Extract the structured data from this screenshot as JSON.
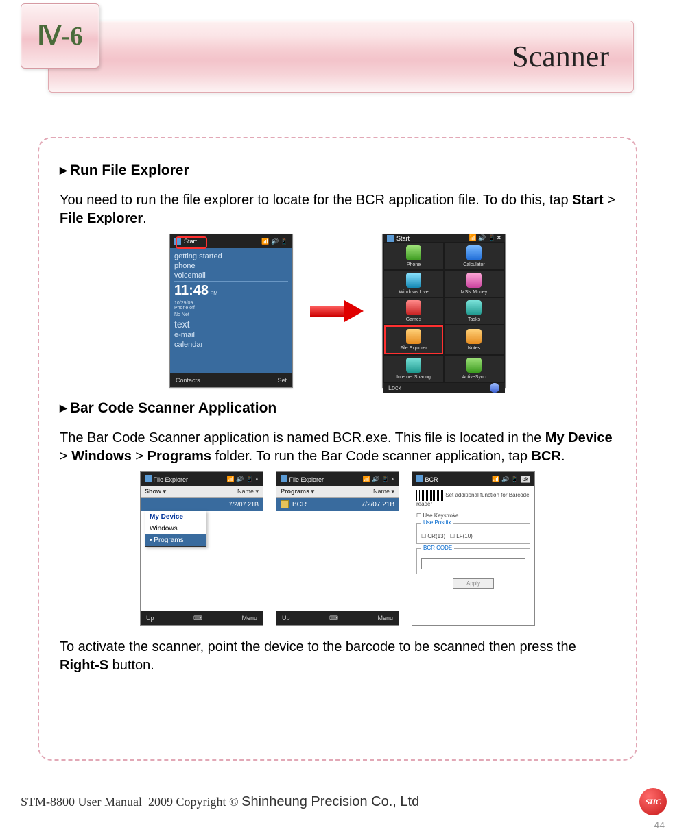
{
  "header": {
    "section_number": "Ⅳ-6",
    "title": "Scanner"
  },
  "section1": {
    "heading": "Run File Explorer",
    "para_before": "You need to run the file explorer to locate for the BCR application file. To do this, tap ",
    "bold1": "Start",
    "mid": " > ",
    "bold2": "File Explorer",
    "after": "."
  },
  "screenA": {
    "start": "Start",
    "lines": [
      "getting started",
      "phone",
      "voicemail"
    ],
    "clock": "11:48",
    "pm": "PM",
    "date": "10/29/09",
    "phoneoff": "Phone off",
    "nonet": "No Net",
    "text": "text",
    "email": "e-mail",
    "calendar": "calendar",
    "foot_l": "Contacts",
    "foot_r": "Set"
  },
  "screenB": {
    "start": "Start",
    "items": [
      {
        "label": "Phone"
      },
      {
        "label": "Calculator"
      },
      {
        "label": "Windows Live"
      },
      {
        "label": "MSN Money"
      },
      {
        "label": "Games"
      },
      {
        "label": "Tasks"
      },
      {
        "label": "File Explorer"
      },
      {
        "label": "Notes"
      },
      {
        "label": "Internet Sharing"
      },
      {
        "label": "ActiveSync"
      }
    ],
    "foot": "Lock"
  },
  "section2": {
    "heading": "Bar Code Scanner Application",
    "para": "The Bar Code Scanner application is named BCR.exe.  This file is located in the ",
    "b1": "My Device",
    "s1": " > ",
    "b2": "Windows",
    "s2": " > ",
    "b3": "Programs",
    "mid": " folder. To run the Bar Code scanner application, tap ",
    "b4": "BCR",
    "end": "."
  },
  "screenC": {
    "title": "File Explorer",
    "sub_l": "Show",
    "sub_r": "Name",
    "row_l": "",
    "row_r": "7/2/07   21B",
    "menu": [
      "My Device",
      "Windows",
      "• Programs"
    ],
    "foot_l": "Up",
    "foot_r": "Menu"
  },
  "screenD": {
    "title": "File Explorer",
    "sub_l": "Programs",
    "sub_r": "Name",
    "item": "BCR",
    "row_r": "7/2/07   21B",
    "foot_l": "Up",
    "foot_r": "Menu"
  },
  "screenE": {
    "title": "BCR",
    "ok": "ok",
    "desc": "Set additional function for Barcode reader",
    "use_keystroke": "Use Keystroke",
    "use_postfix": "Use Postfix",
    "cr": "CR(13)",
    "lf": "LF(10)",
    "bcr_code": "BCR CODE",
    "apply": "Apply"
  },
  "section3": {
    "before": "To activate the scanner, point the device to the barcode to be scanned then press the ",
    "bold": "Right-S",
    "after": " button."
  },
  "footer": {
    "manual": "STM-8800 User Manual",
    "copyright": "2009 Copyright ©",
    "company": "Shinheung Precision Co., Ltd",
    "logo": "SHC",
    "page": "44"
  }
}
